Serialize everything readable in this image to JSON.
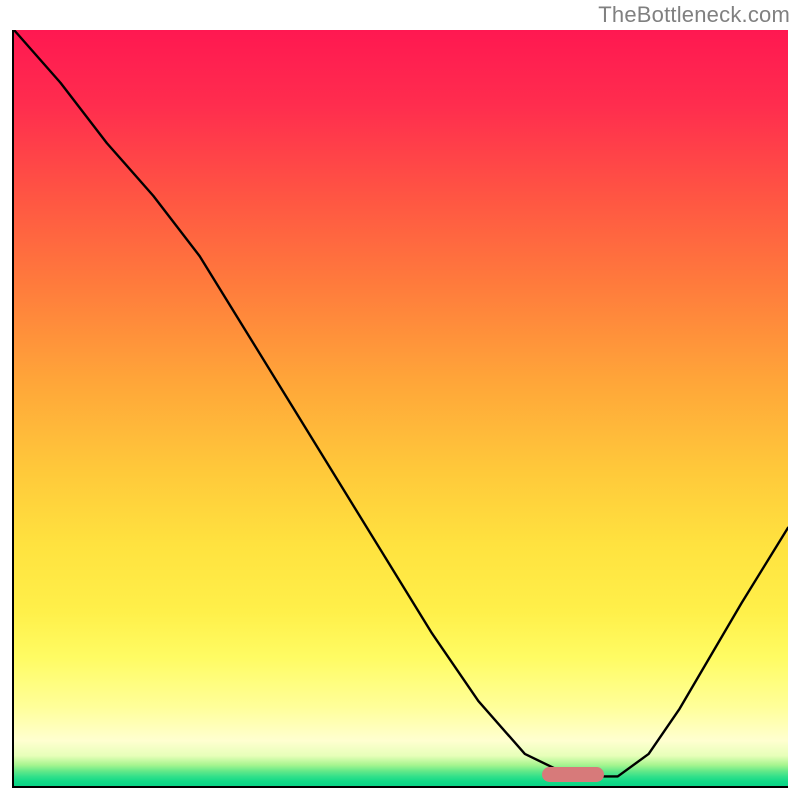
{
  "watermark_text": "TheBottleneck.com",
  "colors": {
    "gradient_top": "#ff1851",
    "gradient_mid": "#ffd13b",
    "gradient_low": "#ffff99",
    "gradient_bottom": "#0ad486",
    "curve_stroke": "#000000",
    "pill_fill": "#d77a7a",
    "axis": "#000000",
    "watermark": "#808080"
  },
  "chart_data": {
    "type": "line",
    "title": "",
    "xlabel": "",
    "ylabel": "",
    "xlim": [
      0,
      100
    ],
    "ylim": [
      0,
      100
    ],
    "series": [
      {
        "name": "bottleneck-curve",
        "x": [
          0,
          6,
          12,
          18,
          24,
          30,
          36,
          42,
          48,
          54,
          60,
          66,
          72,
          74,
          78,
          82,
          86,
          90,
          94,
          100
        ],
        "y": [
          100,
          93,
          85,
          78,
          70,
          60,
          50,
          40,
          30,
          20,
          11,
          4,
          1,
          1,
          1,
          4,
          10,
          17,
          24,
          34
        ]
      }
    ],
    "annotations": [
      {
        "name": "optimal-marker",
        "shape": "pill",
        "x_center": 72,
        "y_center": 1.5,
        "width_pct": 8,
        "color": "#d77a7a"
      }
    ]
  }
}
